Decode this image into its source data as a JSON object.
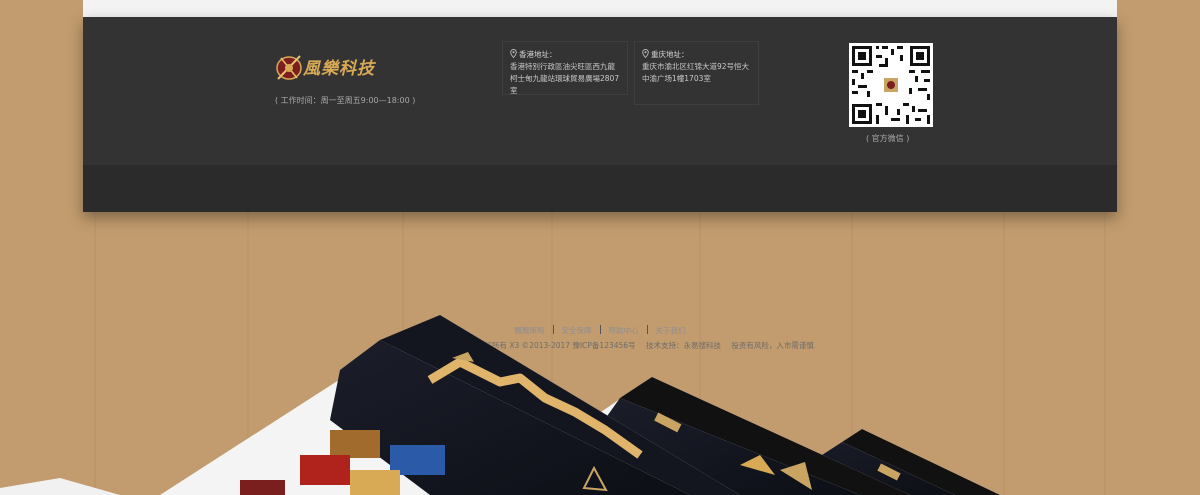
{
  "company": {
    "logo_text": "風樂科技",
    "hours": "( 工作时间：周一至周五9:00—18:00 )"
  },
  "addresses": [
    {
      "title": "香港地址：",
      "line1": "香港特別行政區油尖旺區西九龍",
      "line2": "柯士甸九龍站環球貿易廣場2807室"
    },
    {
      "title": "重庆地址：",
      "line1": "重庆市渝北区红锦大道92号恒大",
      "line2": "中渝广场1幢1703室"
    }
  ],
  "qr": {
    "caption": "( 官方微信 )"
  },
  "footer_links": [
    "飄飄策略",
    "安全保障",
    "帮助中心",
    "关于我们"
  ],
  "copyright": {
    "text": "Powered by 重庆風樂科技版权所有 X3 ©2013-2017 豫ICP备123456号",
    "support": "技术支持：永易搜科技",
    "risk": "投资有风险，入市需谨慎"
  },
  "colors": {
    "background": "#c29c6e",
    "footer": "#333333",
    "footer_bottom": "#2b2b2b",
    "accent": "#d8aa55"
  }
}
